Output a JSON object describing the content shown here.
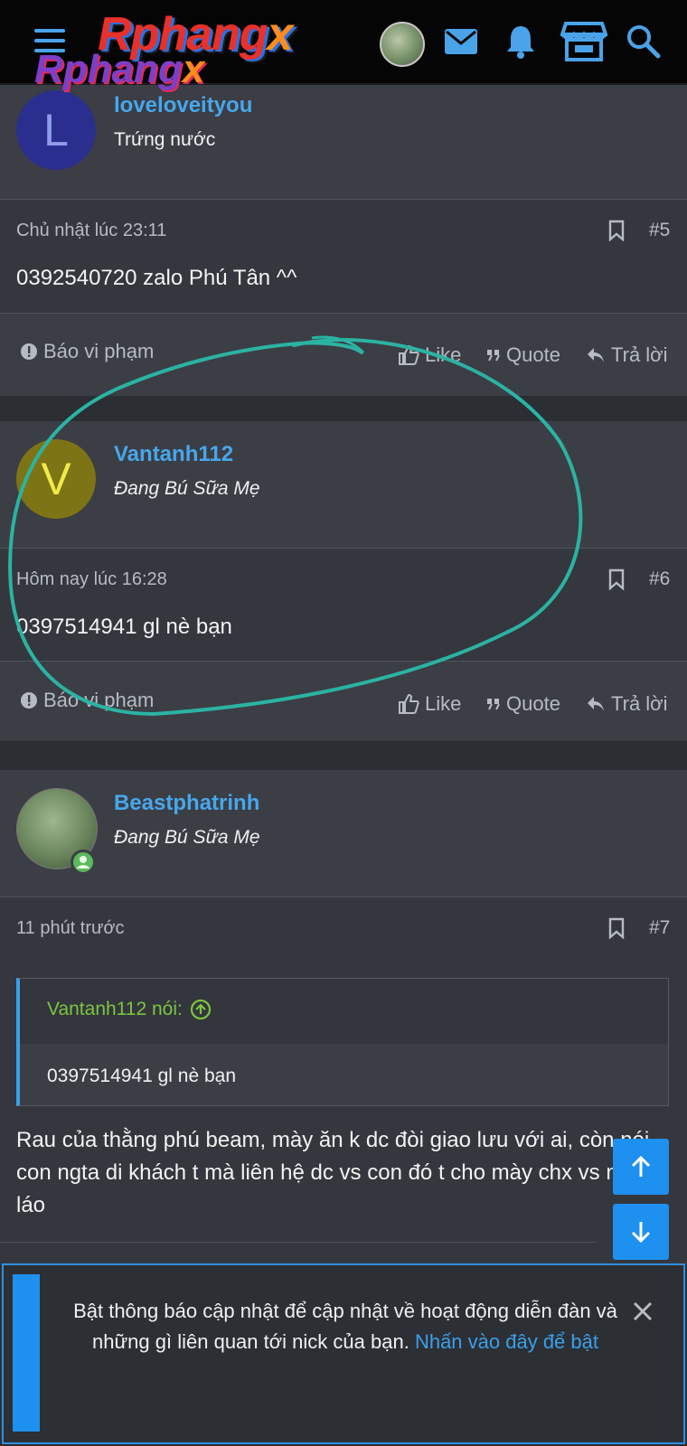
{
  "header": {
    "logo_top": "Rphang",
    "logo_top_x": "x",
    "logo_bottom": "Rphang",
    "logo_bottom_x": "x"
  },
  "posts": [
    {
      "username": "loveloveityou",
      "avatar_letter": "L",
      "avatar_color": "#2a2f8f",
      "user_title": "Trứng nước",
      "time": "Chủ nhật lúc 23:11",
      "number": "#5",
      "message": "0392540720 zalo Phú Tân ^^"
    },
    {
      "username": "Vantanh112",
      "avatar_letter": "V",
      "avatar_color": "#7d7416",
      "user_title": "Đang Bú Sữa Mẹ",
      "time": "Hôm nay lúc 16:28",
      "number": "#6",
      "message": "0397514941 gl nè bạn"
    },
    {
      "username": "Beastphatrinh",
      "user_title": "Đang Bú Sữa Mẹ",
      "time": "11 phút trước",
      "number": "#7",
      "quote_author": "Vantanh112 nói:",
      "quote_text": "0397514941 gl nè bạn",
      "message": "Rau của thằng phú beam, mày ăn k dc đòi giao lưu với ai, còn nói con ngta di khách t mà liên hệ dc vs con đó t cho mày chx vs nó , láo"
    }
  ],
  "actions": {
    "report": "Báo vi phạm",
    "like": "Like",
    "quote": "Quote",
    "reply": "Trả lời"
  },
  "notice": {
    "text": "Bật thông báo cập nhật để cập nhật về hoạt động diễn đàn và những gì liên quan tới nick của bạn.",
    "link": "Nhấn vào đây để bật"
  },
  "colors": {
    "accent": "#47a7eb",
    "card_bg": "#3b3e45",
    "page_bg": "#2b2e33",
    "online": "#5cb85c",
    "quote_green": "#7dc441"
  }
}
